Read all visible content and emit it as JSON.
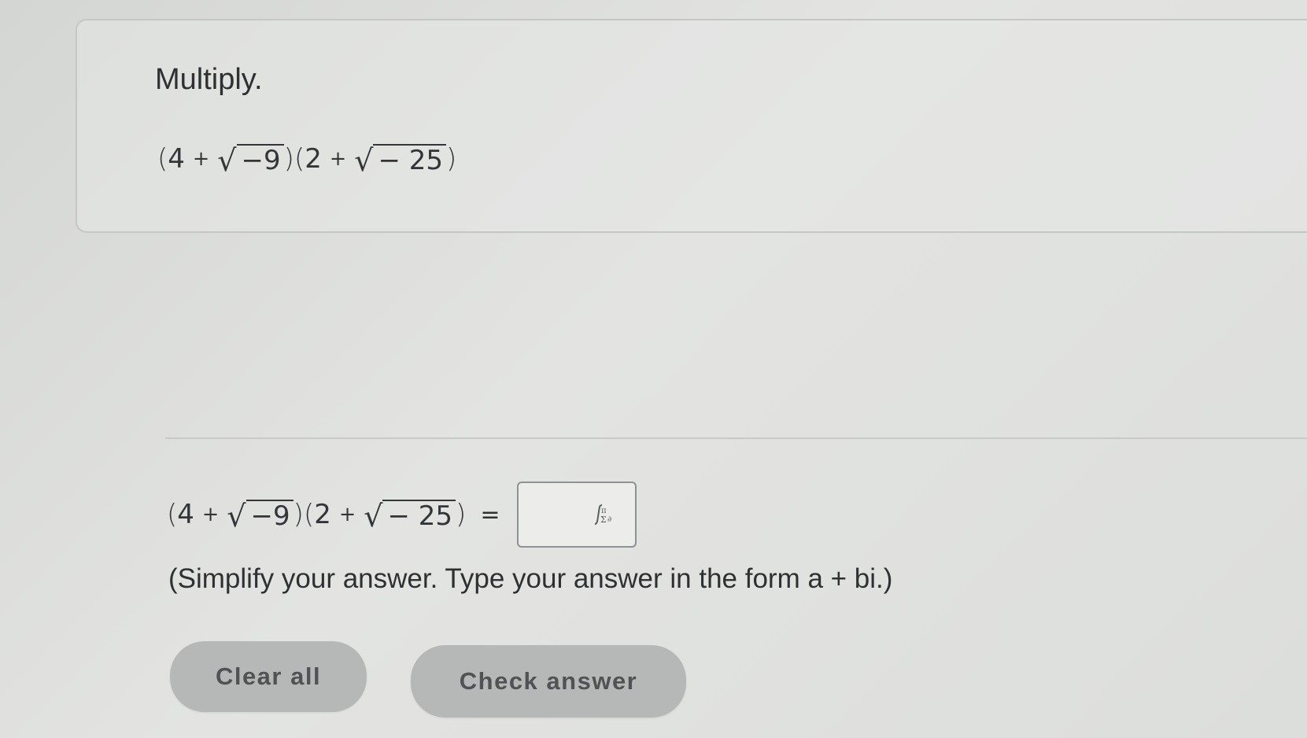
{
  "question": {
    "title": "Multiply.",
    "expression": {
      "open1": "(",
      "a1": "4",
      "plus1": "+",
      "rad1": "−9",
      "close1": ")",
      "open2": "(",
      "a2": "2",
      "plus2": "+",
      "rad2": "− 25",
      "close2": ")"
    }
  },
  "answer": {
    "expression": {
      "open1": "(",
      "a1": "4",
      "plus1": "+",
      "rad1": "−9",
      "close1": ")",
      "open2": "(",
      "a2": "2",
      "plus2": "+",
      "rad2": "− 25",
      "close2": ")"
    },
    "equals": "=",
    "input_value": "",
    "input_icon": "math-palette-icon",
    "instruction": "(Simplify your answer. Type your answer in the form a + bi.)"
  },
  "buttons": {
    "clear_all": "Clear all",
    "check_answer": "Check answer"
  },
  "colors": {
    "background": "#dcdedb",
    "button": "#b6b8b7",
    "button_text": "#505254",
    "text": "#2f3133"
  }
}
